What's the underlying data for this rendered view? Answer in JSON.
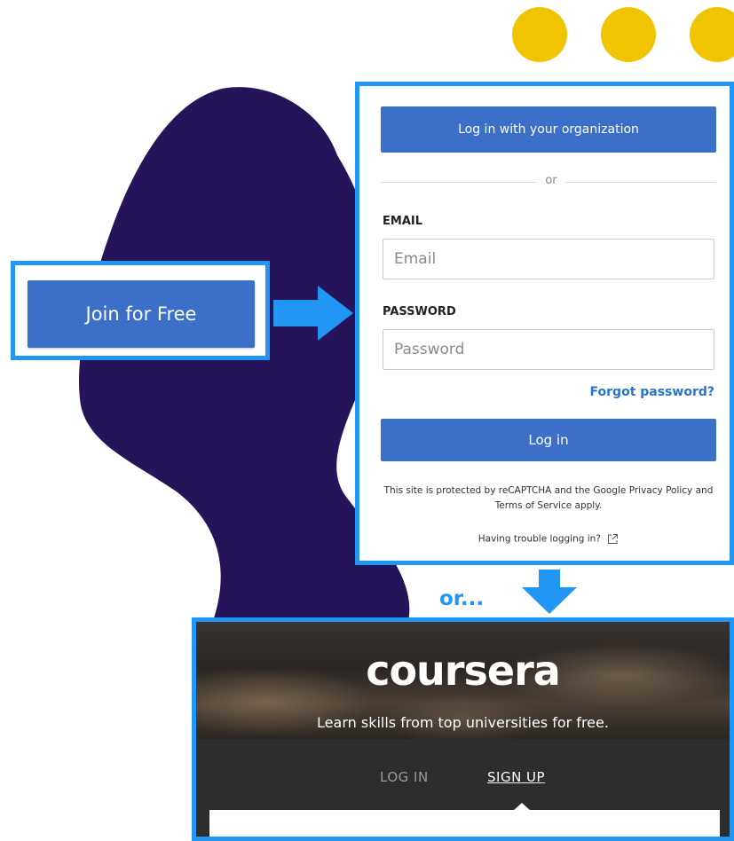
{
  "colors": {
    "highlight_border": "#2196f3",
    "button_blue": "#3b6fc8",
    "blob_purple": "#25145a",
    "dot_yellow": "#f1c400",
    "link_blue": "#2a73cc"
  },
  "left": {
    "join_button_label": "Join for Free"
  },
  "login": {
    "org_button_label": "Log in with your organization",
    "divider_text": "or",
    "email_label": "EMAIL",
    "email_placeholder": "Email",
    "password_label": "PASSWORD",
    "password_placeholder": "Password",
    "forgot_link": "Forgot password?",
    "login_button_label": "Log in",
    "recaptcha_text": "This site is protected by reCAPTCHA and the Google Privacy Policy and Terms of Service apply.",
    "trouble_text": "Having trouble logging in?",
    "trouble_icon": "external-link-icon"
  },
  "connector": {
    "or_text": "or..."
  },
  "coursera": {
    "logo_text": "coursera",
    "tagline": "Learn skills from top universities for free.",
    "tab_login": "LOG IN",
    "tab_signup": "SIGN UP",
    "active_tab": "SIGN UP"
  }
}
